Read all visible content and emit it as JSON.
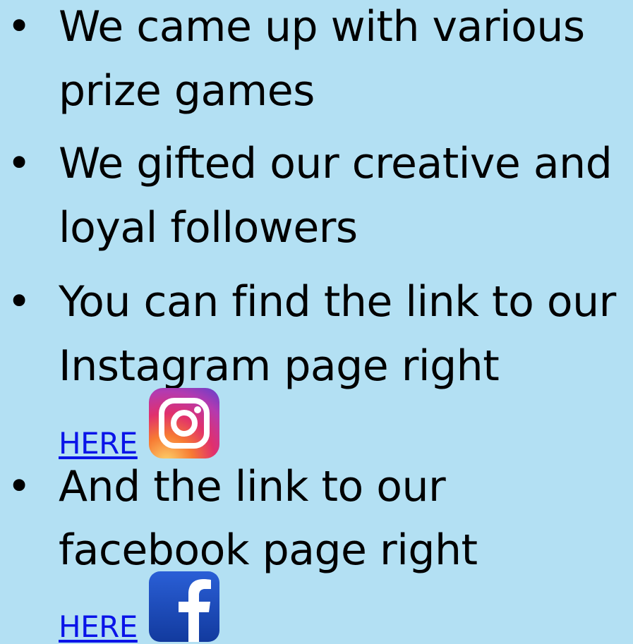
{
  "bullets": [
    {
      "lines": [
        "We came up with various",
        "prize games"
      ]
    },
    {
      "lines": [
        "We gifted our creative and",
        "loyal followers"
      ]
    },
    {
      "lines": [
        "You can find the link to our",
        "Instagram page right"
      ],
      "link_label": "HERE",
      "icon": "instagram-icon"
    },
    {
      "lines": [
        "And the link to our",
        "facebook page right"
      ],
      "link_label": "HERE",
      "icon": "facebook-icon"
    }
  ],
  "colors": {
    "background": "#b3e0f3",
    "text": "#000000",
    "link": "#0a14e8",
    "facebook": "#1a46b8"
  }
}
